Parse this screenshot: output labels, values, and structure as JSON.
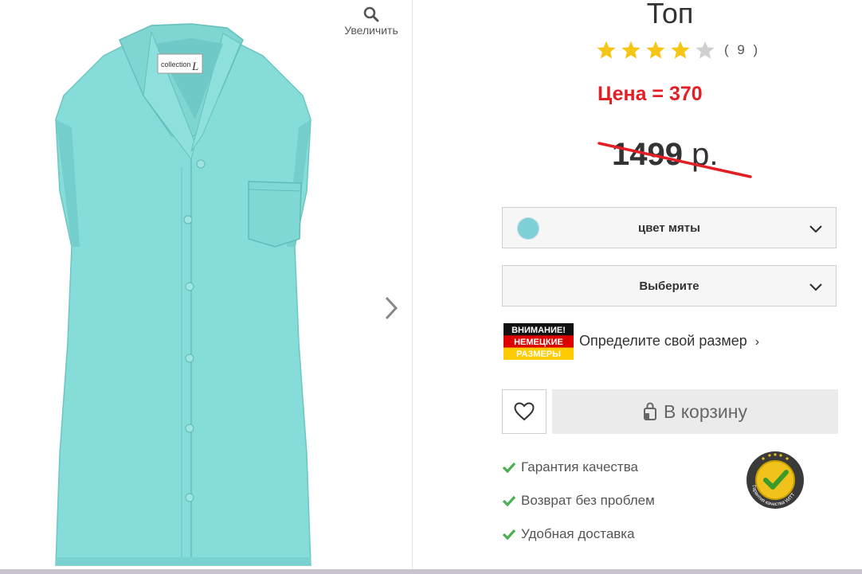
{
  "gallery": {
    "zoom_label": "Увеличить",
    "label_tag": "collection L"
  },
  "product": {
    "title": "Топ",
    "rating": {
      "stars_filled": 4,
      "stars_total": 5,
      "count": "( 9 )"
    },
    "price_note": "Цена = 370",
    "old_price": {
      "amount": "1499",
      "currency": "р."
    }
  },
  "selectors": {
    "color": {
      "value": "цвет мяты",
      "swatch": "#7fcfd6"
    },
    "size": {
      "value": "Выберите"
    }
  },
  "size_hint": {
    "banner_lines": [
      "ВНИМАНИЕ!",
      "НЕМЕЦКИЕ",
      "РАЗМЕРЫ"
    ],
    "link": "Определите свой размер",
    "arrow": "›"
  },
  "actions": {
    "wishlist_icon": "heart-icon",
    "cart_label": "В корзину",
    "cart_icon": "shopping-bag-icon"
  },
  "benefits": [
    {
      "text": "Гарантия качества"
    },
    {
      "text": "Возврат без проблем"
    },
    {
      "text": "Удобная доставка"
    }
  ],
  "seal": {
    "text": "Гарантия качества WITT"
  },
  "colors": {
    "accent_red": "#e41e25",
    "check_green": "#4caf50",
    "star_gold": "#f5c518",
    "star_grey": "#d0d0d0",
    "shirt": "#86dcd8"
  }
}
